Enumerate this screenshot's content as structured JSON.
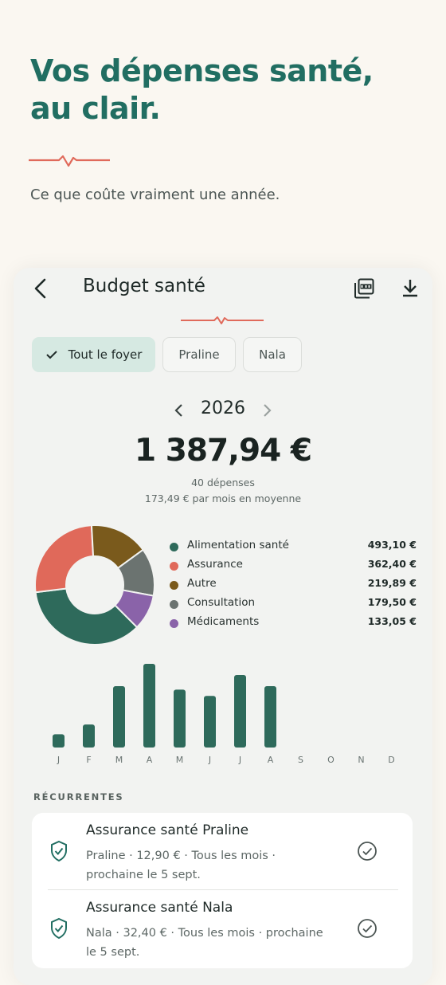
{
  "hero": {
    "title": "Vos dépenses santé, au clair.",
    "subtitle": "Ce que coûte vraiment une année.",
    "accent_color": "#216e62",
    "ecg_color": "#e06a5b"
  },
  "app": {
    "title": "Budget santé",
    "icons": {
      "back": "chevron-left-icon",
      "pdf": "pdf-icon",
      "download": "download-icon"
    },
    "filters": [
      {
        "label": "Tout le foyer",
        "selected": true
      },
      {
        "label": "Praline",
        "selected": false
      },
      {
        "label": "Nala",
        "selected": false
      }
    ],
    "year": "2026",
    "total": "1 387,94 €",
    "count": "40 dépenses",
    "monthly_average": "173,49 € par mois en moyenne"
  },
  "chart_data": [
    {
      "type": "pie",
      "categories": [
        "Alimentation santé",
        "Assurance",
        "Autre",
        "Consultation",
        "Médicaments"
      ],
      "values": [
        493.1,
        362.4,
        219.89,
        179.5,
        133.05
      ],
      "labels": [
        "493,10 €",
        "362,40 €",
        "219,89 €",
        "179,50 €",
        "133,05 €"
      ],
      "colors": [
        "#2e6a5b",
        "#e0695a",
        "#7a5a1c",
        "#6b7370",
        "#8a63a9"
      ],
      "legend": "right"
    },
    {
      "type": "bar",
      "categories": [
        "J",
        "F",
        "M",
        "A",
        "M",
        "J",
        "J",
        "A",
        "S",
        "O",
        "N",
        "D"
      ],
      "values": [
        19,
        33,
        88,
        120,
        83,
        74,
        104,
        88,
        0,
        0,
        0,
        0
      ],
      "color": "#2e6a5b",
      "grid": false
    }
  ],
  "recurring": {
    "section_label": "RÉCURRENTES",
    "items": [
      {
        "title": "Assurance santé Praline",
        "detail": "Praline · 12,90 € · Tous les mois · prochaine le 5 sept.",
        "icon": "shield-icon",
        "status_icon": "check-circle-icon"
      },
      {
        "title": "Assurance santé Nala",
        "detail": "Nala · 32,40 € · Tous les mois · prochaine le 5 sept.",
        "icon": "shield-icon",
        "status_icon": "check-circle-icon"
      }
    ]
  }
}
